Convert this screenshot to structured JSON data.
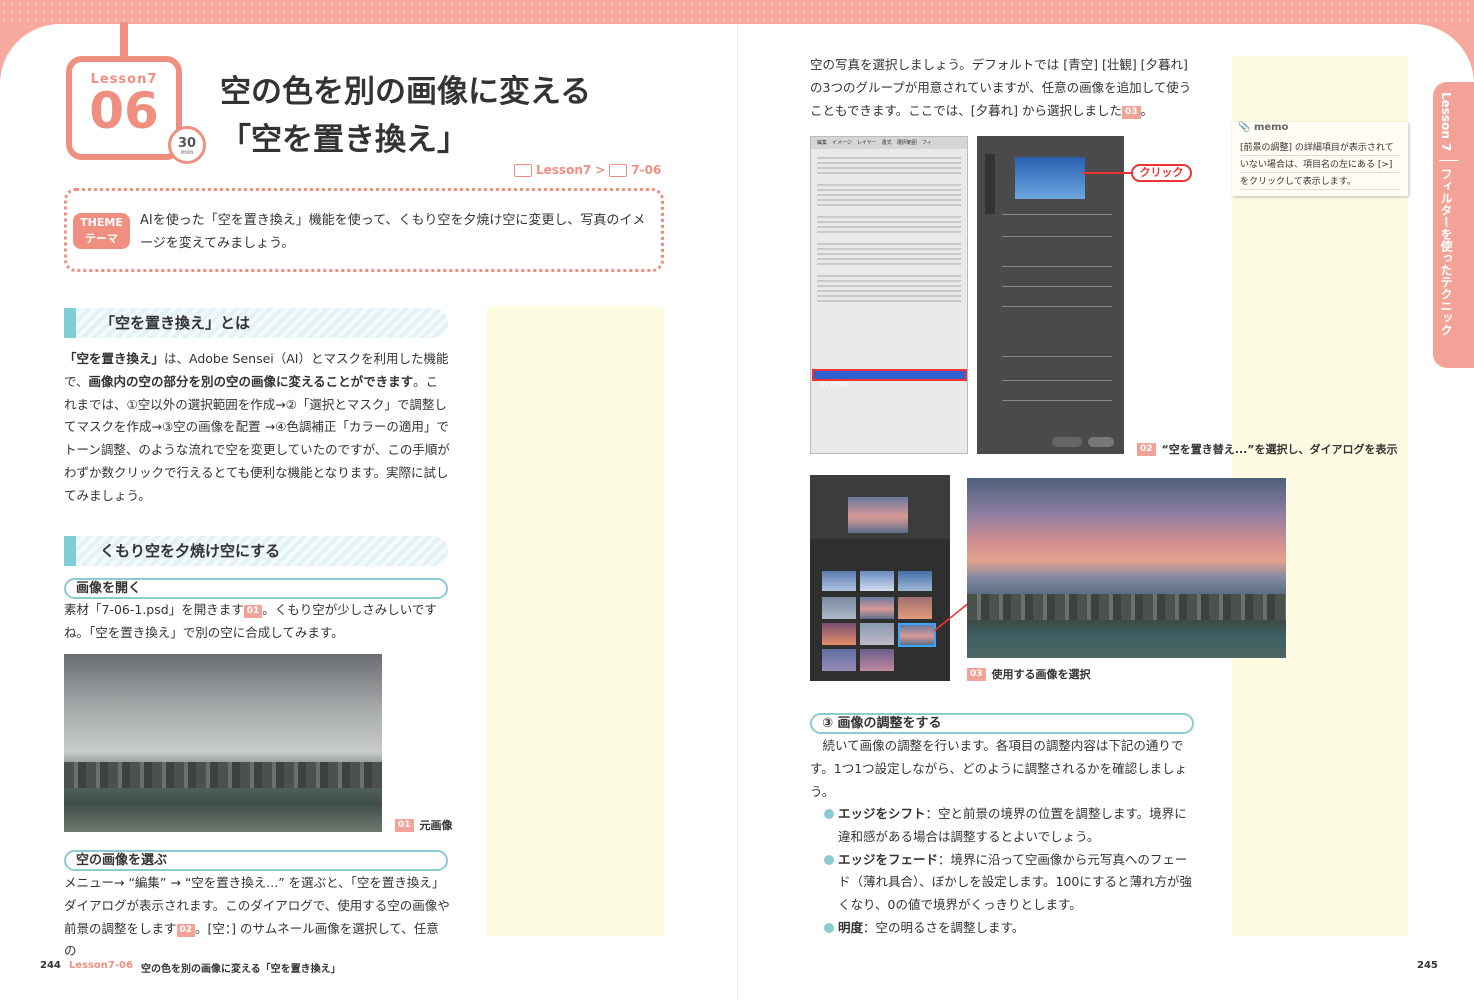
{
  "header": {
    "lesson_label": "Lesson7",
    "lesson_number": "06",
    "time_minutes": "30",
    "time_unit": "min",
    "title_line1": "空の色を別の画像に変える",
    "title_line2": "「空を置き換え」",
    "path_part1": "Lesson7",
    "path_sep": ">",
    "path_part2": "7-06"
  },
  "theme": {
    "tag_en": "THEME",
    "tag_ja": "テーマ",
    "text": "AIを使った「空を置き換え」機能を使って、くもり空を夕焼け空に変更し、写真のイメージを変えてみましょう。"
  },
  "section1": {
    "heading": "「空を置き換え」とは",
    "lead_bold1": "「空を置き換え」",
    "lead_text1": "は、Adobe Sensei（AI）とマスクを利用した機能で、",
    "lead_bold2": "画像内の空の部分を別の空の画像に変えることができます",
    "lead_text2": "。これまでは、①空以外の選択範囲を作成→②「選択とマスク」で調整してマスクを作成→③空の画像を配置 →④色調補正「カラーの適用」でトーン調整、のような流れで空を変更していたのですが、この手順がわずか数クリックで行えるとても便利な機能となります。実際に試してみましょう。"
  },
  "section2": {
    "heading": "くもり空を夕焼け空にする",
    "step1": {
      "heading": "画像を開く",
      "text_a": "素材「7-06-1.psd」を開きます",
      "ref": "01",
      "text_b": "。くもり空が少しさみしいですね。「空を置き換え」で別の空に合成してみます。"
    },
    "fig1_ref": "01",
    "fig1_caption": "元画像",
    "step2": {
      "heading": "空の画像を選ぶ",
      "text_a": "メニュー→ “編集” → “空を置き換え...” を選ぶと、「空を置き換え」ダイアログが表示されます。このダイアログで、使用する空の画像や前景の調整をします",
      "ref": "02",
      "text_b": "。[空：] のサムネール画像を選択して、任意の"
    }
  },
  "right": {
    "intro_a": "空の写真を選択しましょう。デフォルトでは [青空] [壮観] [夕暮れ] の3つのグループが用意されていますが、任意の画像を追加して使うこともできます。ここでは、[夕暮れ] から選択しました",
    "intro_ref": "03",
    "intro_b": "。",
    "menu_bar": "編集　イメージ　レイヤー　書式　選択範囲　フィ",
    "menu_highlight": "空を置き換え...",
    "click_label": "クリック",
    "fig2_ref": "02",
    "fig2_caption": "“空を置き替え...”を選択し、ダイアログを表示",
    "fig3_ref": "03",
    "fig3_caption": "使用する画像を選択",
    "step3": {
      "heading": "③ 画像の調整をする",
      "text": "続いて画像の調整を行います。各項目の調整内容は下記の通りです。1つ1つ設定しながら、どのように調整されるかを確認しましょう。"
    },
    "bullets": [
      {
        "term": "エッジをシフト",
        "desc": "：空と前景の境界の位置を調整します。境界に違和感がある場合は調整するとよいでしょう。"
      },
      {
        "term": "エッジをフェード",
        "desc": "：境界に沿って空画像から元写真へのフェード（薄れ具合）、ぼかしを設定します。100にすると薄れ方が強くなり、0の値で境界がくっきりとします。"
      },
      {
        "term": "明度",
        "desc": "：空の明るさを調整します。"
      }
    ]
  },
  "memo": {
    "title": "memo",
    "text": "[前景の調整] の詳細項目が表示されていない場合は、項目名の左にある [>] をクリックして表示します。"
  },
  "side_tab": {
    "lesson": "Lesson 7",
    "topic": "フィルターを使ったテクニック"
  },
  "footer": {
    "page_left": "244",
    "lesson_ref": "Lesson7-06",
    "title": "空の色を別の画像に変える「空を置き換え」",
    "page_right": "245"
  },
  "colors": {
    "accent": "#f08e80",
    "teal": "#80ccd7",
    "highlight_blue": "#2f5fd0",
    "alert_red": "#ee3333"
  }
}
